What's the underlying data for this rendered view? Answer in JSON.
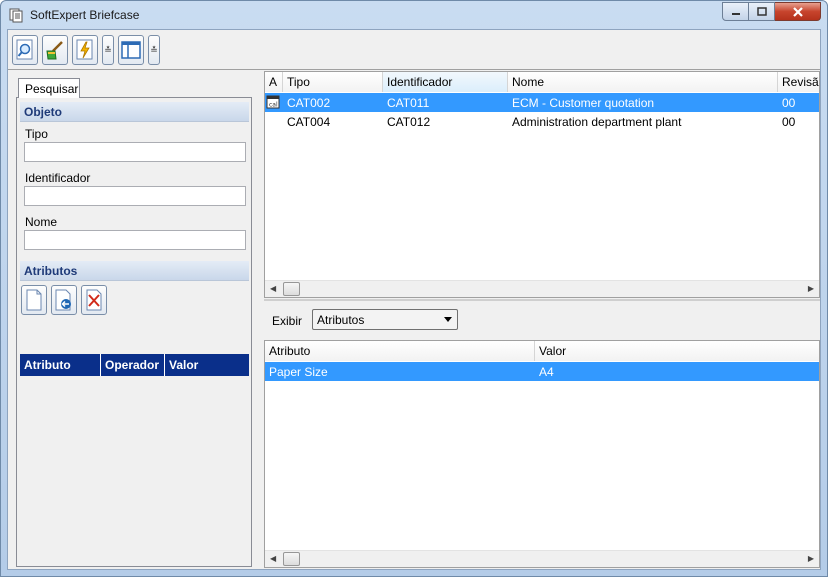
{
  "window": {
    "title": "SoftExpert Briefcase"
  },
  "toolbar": {
    "buttons": [
      "search-icon",
      "broom-clean-icon",
      "lightning-document-icon",
      "panel-layout-icon"
    ]
  },
  "left_panel": {
    "tab_label": "Pesquisar",
    "objeto_header": "Objeto",
    "fields": [
      {
        "label": "Tipo",
        "value": ""
      },
      {
        "label": "Identificador",
        "value": ""
      },
      {
        "label": "Nome",
        "value": ""
      }
    ],
    "atributos_header": "Atributos",
    "attr_columns": [
      "Atributo",
      "Operador",
      "Valor"
    ]
  },
  "results_grid": {
    "columns": [
      "A",
      "Tipo",
      "Identificador",
      "Nome",
      "Revisão"
    ],
    "rows": [
      {
        "tipo": "CAT002",
        "identificador": "CAT011",
        "nome": "ECM - Customer quotation",
        "revisao": "00",
        "selected": true
      },
      {
        "tipo": "CAT004",
        "identificador": "CAT012",
        "nome": "Administration department plant",
        "revisao": "00",
        "selected": false
      }
    ]
  },
  "detail": {
    "exibir_label": "Exibir",
    "exibir_value": "Atributos",
    "columns": [
      "Atributo",
      "Valor"
    ],
    "rows": [
      {
        "atributo": "Paper Size",
        "valor": "A4",
        "selected": true
      }
    ]
  },
  "colors": {
    "selection": "#3399ff",
    "attr_header": "#0a2f8a",
    "section_text": "#1e3a78"
  }
}
